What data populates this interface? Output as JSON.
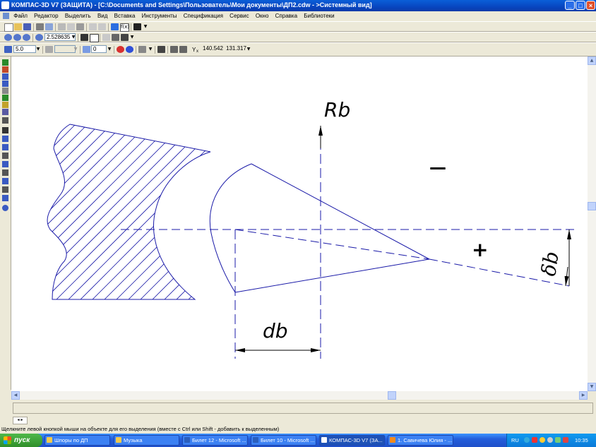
{
  "window": {
    "title": "КОМПАС-3D V7 (ЗАЩИТА) - [C:\\Documents and Settings\\Пользователь\\Мои документы\\ДП2.cdw - >Системный вид]",
    "buttons": {
      "minimize": "_",
      "maximize": "□",
      "close": "×"
    }
  },
  "menu": {
    "items": [
      "Файл",
      "Редактор",
      "Выделить",
      "Вид",
      "Вставка",
      "Инструменты",
      "Спецификация",
      "Сервис",
      "Окно",
      "Справка",
      "Библиотеки"
    ],
    "doc_controls": [
      "_",
      "▫",
      "×"
    ]
  },
  "toolbar2": {
    "zoom_value": "2.528635"
  },
  "toolbar3": {
    "step_value": "5.0",
    "layer_value": "0",
    "coord_label": "Y",
    "coord_sub": "x",
    "x_value": "140.542",
    "y_value": "131.317"
  },
  "drawing": {
    "labels": {
      "rb": "Rb",
      "db": "db",
      "delta": "δb",
      "minus": "—",
      "plus": "+"
    },
    "colors": {
      "line": "#1a1aa8",
      "hatch": "#1a1aa8",
      "text": "#000000"
    }
  },
  "status": {
    "page_nav": "◂ ▸",
    "hint": "Щелкните левой кнопкой мыши на объекте для его выделения (вместе с Ctrl или Shift - добавить к выделенным)"
  },
  "taskbar": {
    "start": "пуск",
    "tasks": [
      {
        "label": "Шпоры по ДП",
        "icon_color": "#f2c94c"
      },
      {
        "label": "Музыка",
        "icon_color": "#f2c94c"
      },
      {
        "label": "Билет 12 - Microsoft ...",
        "icon_color": "#2b5fbd"
      },
      {
        "label": "Билет 10 - Microsoft ...",
        "icon_color": "#2b5fbd"
      },
      {
        "label": "КОМПАС-3D V7 (ЗА...",
        "icon_color": "#ffffff"
      },
      {
        "label": "1. Савичева Юлия - ...",
        "icon_color": "#f28a1e"
      }
    ],
    "tray": {
      "lang": "RU",
      "time": "10:35"
    }
  }
}
